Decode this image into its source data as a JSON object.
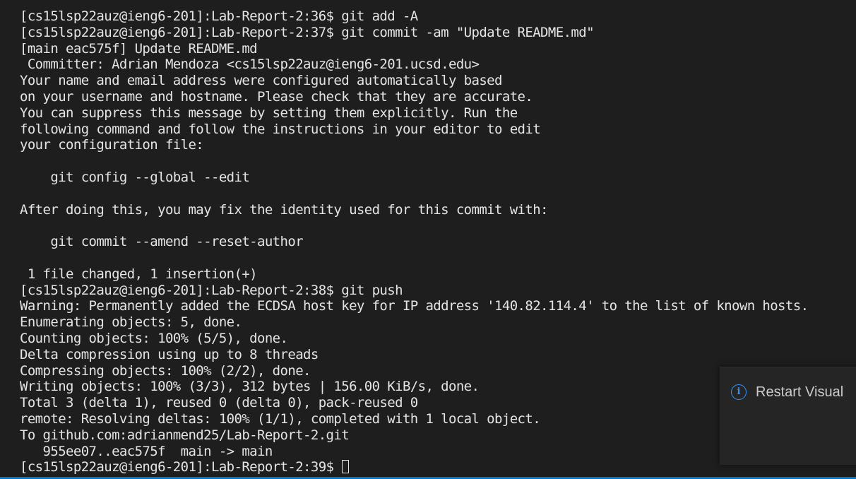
{
  "terminal": {
    "lines": [
      "[cs15lsp22auz@ieng6-201]:Lab-Report-2:36$ git add -A",
      "[cs15lsp22auz@ieng6-201]:Lab-Report-2:37$ git commit -am \"Update README.md\"",
      "[main eac575f] Update README.md",
      " Committer: Adrian Mendoza <cs15lsp22auz@ieng6-201.ucsd.edu>",
      "Your name and email address were configured automatically based",
      "on your username and hostname. Please check that they are accurate.",
      "You can suppress this message by setting them explicitly. Run the",
      "following command and follow the instructions in your editor to edit",
      "your configuration file:",
      "",
      "    git config --global --edit",
      "",
      "After doing this, you may fix the identity used for this commit with:",
      "",
      "    git commit --amend --reset-author",
      "",
      " 1 file changed, 1 insertion(+)",
      "[cs15lsp22auz@ieng6-201]:Lab-Report-2:38$ git push",
      "Warning: Permanently added the ECDSA host key for IP address '140.82.114.4' to the list of known hosts.",
      "Enumerating objects: 5, done.",
      "Counting objects: 100% (5/5), done.",
      "Delta compression using up to 8 threads",
      "Compressing objects: 100% (2/2), done.",
      "Writing objects: 100% (3/3), 312 bytes | 156.00 KiB/s, done.",
      "Total 3 (delta 1), reused 0 (delta 0), pack-reused 0",
      "remote: Resolving deltas: 100% (1/1), completed with 1 local object.",
      "To github.com:adrianmend25/Lab-Report-2.git",
      "   955ee07..eac575f  main -> main"
    ],
    "prompt": "[cs15lsp22auz@ieng6-201]:Lab-Report-2:39$ "
  },
  "notification": {
    "icon": "info-icon",
    "glyph": "i",
    "message": "Restart Visual"
  },
  "colors": {
    "background": "#1e1e1e",
    "text": "#e4e4e4",
    "accent": "#3794ff",
    "notification_bg": "#252526"
  }
}
